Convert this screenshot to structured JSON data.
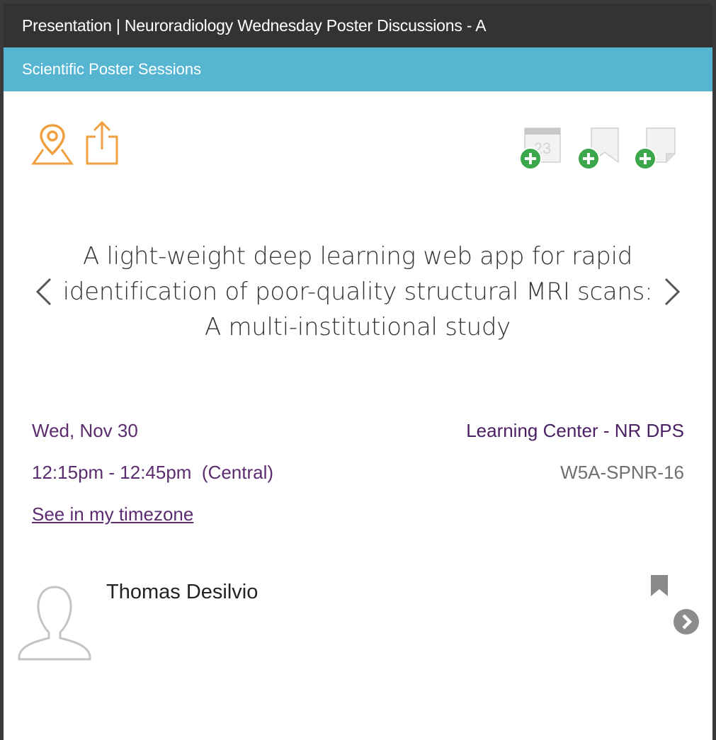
{
  "header": {
    "title": "Presentation | Neuroradiology Wednesday Poster Discussions - A",
    "subtitle": "Scientific Poster Sessions"
  },
  "toolbar": {
    "left_icons": [
      "map-pin-icon",
      "share-icon"
    ],
    "right_icons": [
      "add-to-calendar-icon",
      "add-bookmark-icon",
      "add-note-icon"
    ],
    "calendar_day": "23"
  },
  "presentation": {
    "title_lines": [
      "A light-weight deep learning web app for rapid",
      "identification of poor-quality structural MRI scans:",
      "A multi-institutional study"
    ],
    "date": "Wed, Nov 30",
    "time": "12:15pm - 12:45pm  (Central)",
    "timezone_link": "See in my timezone",
    "location": "Learning Center - NR DPS",
    "code": "W5A-SPNR-16"
  },
  "author": {
    "name": "Thomas Desilvio"
  },
  "colors": {
    "title_bar": "#333333",
    "sub_bar": "#56b6d2",
    "accent_orange": "#f0a040",
    "add_green": "#3aa84a",
    "purple_text": "#5b2c6f"
  }
}
